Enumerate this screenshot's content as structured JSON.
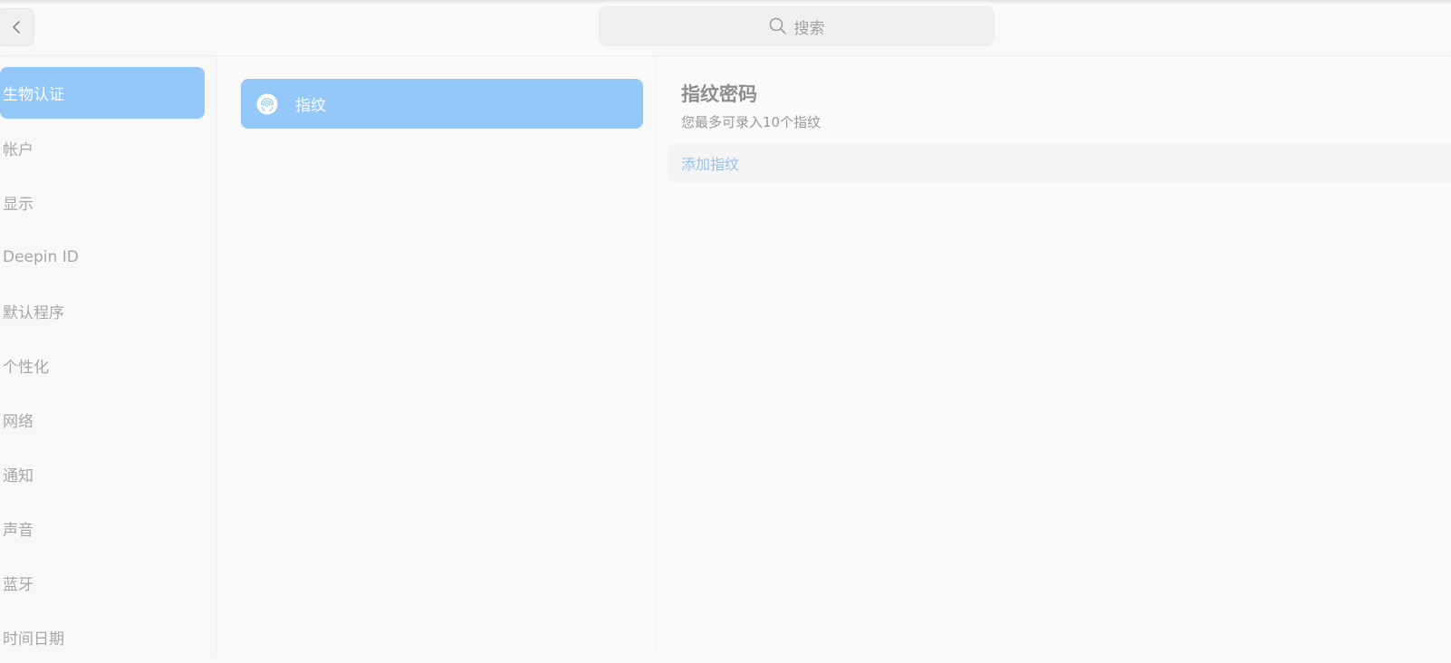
{
  "search": {
    "placeholder": "搜索"
  },
  "sidebar": {
    "items": [
      {
        "label": "生物认证",
        "active": true
      },
      {
        "label": "帐户"
      },
      {
        "label": "显示"
      },
      {
        "label": "Deepin ID"
      },
      {
        "label": "默认程序"
      },
      {
        "label": "个性化"
      },
      {
        "label": "网络"
      },
      {
        "label": "通知"
      },
      {
        "label": "声音"
      },
      {
        "label": "蓝牙"
      },
      {
        "label": "时间日期"
      }
    ]
  },
  "middle": {
    "items": [
      {
        "label": "指纹",
        "icon": "fingerprint-icon",
        "active": true
      }
    ]
  },
  "content": {
    "title": "指纹密码",
    "subtitle": "您最多可录入10个指纹",
    "add_label": "添加指纹"
  },
  "colors": {
    "accent": "#94c8f9",
    "link": "#93c3f2"
  }
}
